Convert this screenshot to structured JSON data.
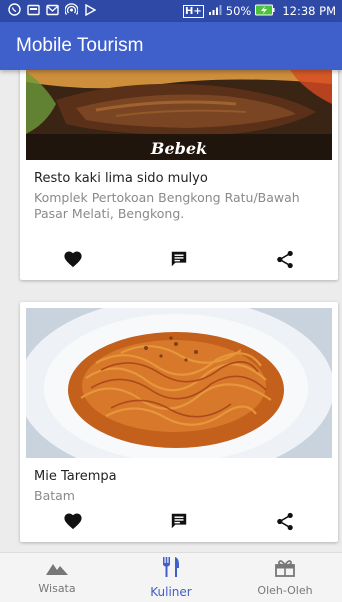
{
  "status_bar": {
    "network_label": "H+",
    "battery": "50%",
    "time": "12:38 PM",
    "icons": [
      "whatsapp-icon",
      "notification-icon",
      "gmail-icon",
      "hotspot-icon",
      "play-icon",
      "signal-icon",
      "battery-charging-icon"
    ]
  },
  "app_bar": {
    "title": "Mobile Tourism"
  },
  "cards": [
    {
      "image_caption": "Bebek",
      "name": "Resto kaki lima sido mulyo",
      "address": "Komplek Pertokoan Bengkong Ratu/Bawah Pasar Melati, Bengkong."
    },
    {
      "image_caption": "",
      "name": "Mie Tarempa",
      "address": "Batam"
    }
  ],
  "card_actions": [
    "favorite-icon",
    "comment-icon",
    "share-icon"
  ],
  "bottom_nav": {
    "items": [
      {
        "label": "Wisata",
        "icon": "mountain-icon",
        "active": false
      },
      {
        "label": "Kuliner",
        "icon": "restaurant-icon",
        "active": true
      },
      {
        "label": "Oleh-Oleh",
        "icon": "gift-icon",
        "active": false
      }
    ]
  },
  "colors": {
    "status_bar": "#2f4aa6",
    "app_bar": "#3f5fca",
    "accent": "#3f5fca",
    "background": "#ececec"
  }
}
